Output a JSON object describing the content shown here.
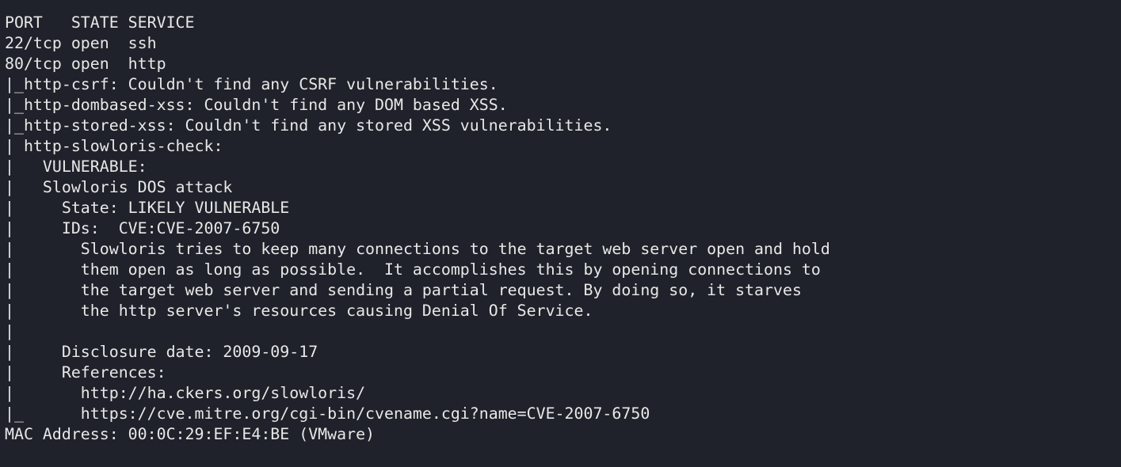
{
  "terminal": {
    "background": "#1f222a",
    "foreground": "#e8e8e8",
    "lines": [
      "PORT   STATE SERVICE",
      "22/tcp open  ssh",
      "80/tcp open  http",
      "|_http-csrf: Couldn't find any CSRF vulnerabilities.",
      "|_http-dombased-xss: Couldn't find any DOM based XSS.",
      "|_http-stored-xss: Couldn't find any stored XSS vulnerabilities.",
      "| http-slowloris-check: ",
      "|   VULNERABLE:",
      "|   Slowloris DOS attack",
      "|     State: LIKELY VULNERABLE",
      "|     IDs:  CVE:CVE-2007-6750",
      "|       Slowloris tries to keep many connections to the target web server open and hold",
      "|       them open as long as possible.  It accomplishes this by opening connections to",
      "|       the target web server and sending a partial request. By doing so, it starves",
      "|       the http server's resources causing Denial Of Service.",
      "|       ",
      "|     Disclosure date: 2009-09-17",
      "|     References:",
      "|       http://ha.ckers.org/slowloris/",
      "|_      https://cve.mitre.org/cgi-bin/cvename.cgi?name=CVE-2007-6750",
      "MAC Address: 00:0C:29:EF:E4:BE (VMware)"
    ]
  }
}
